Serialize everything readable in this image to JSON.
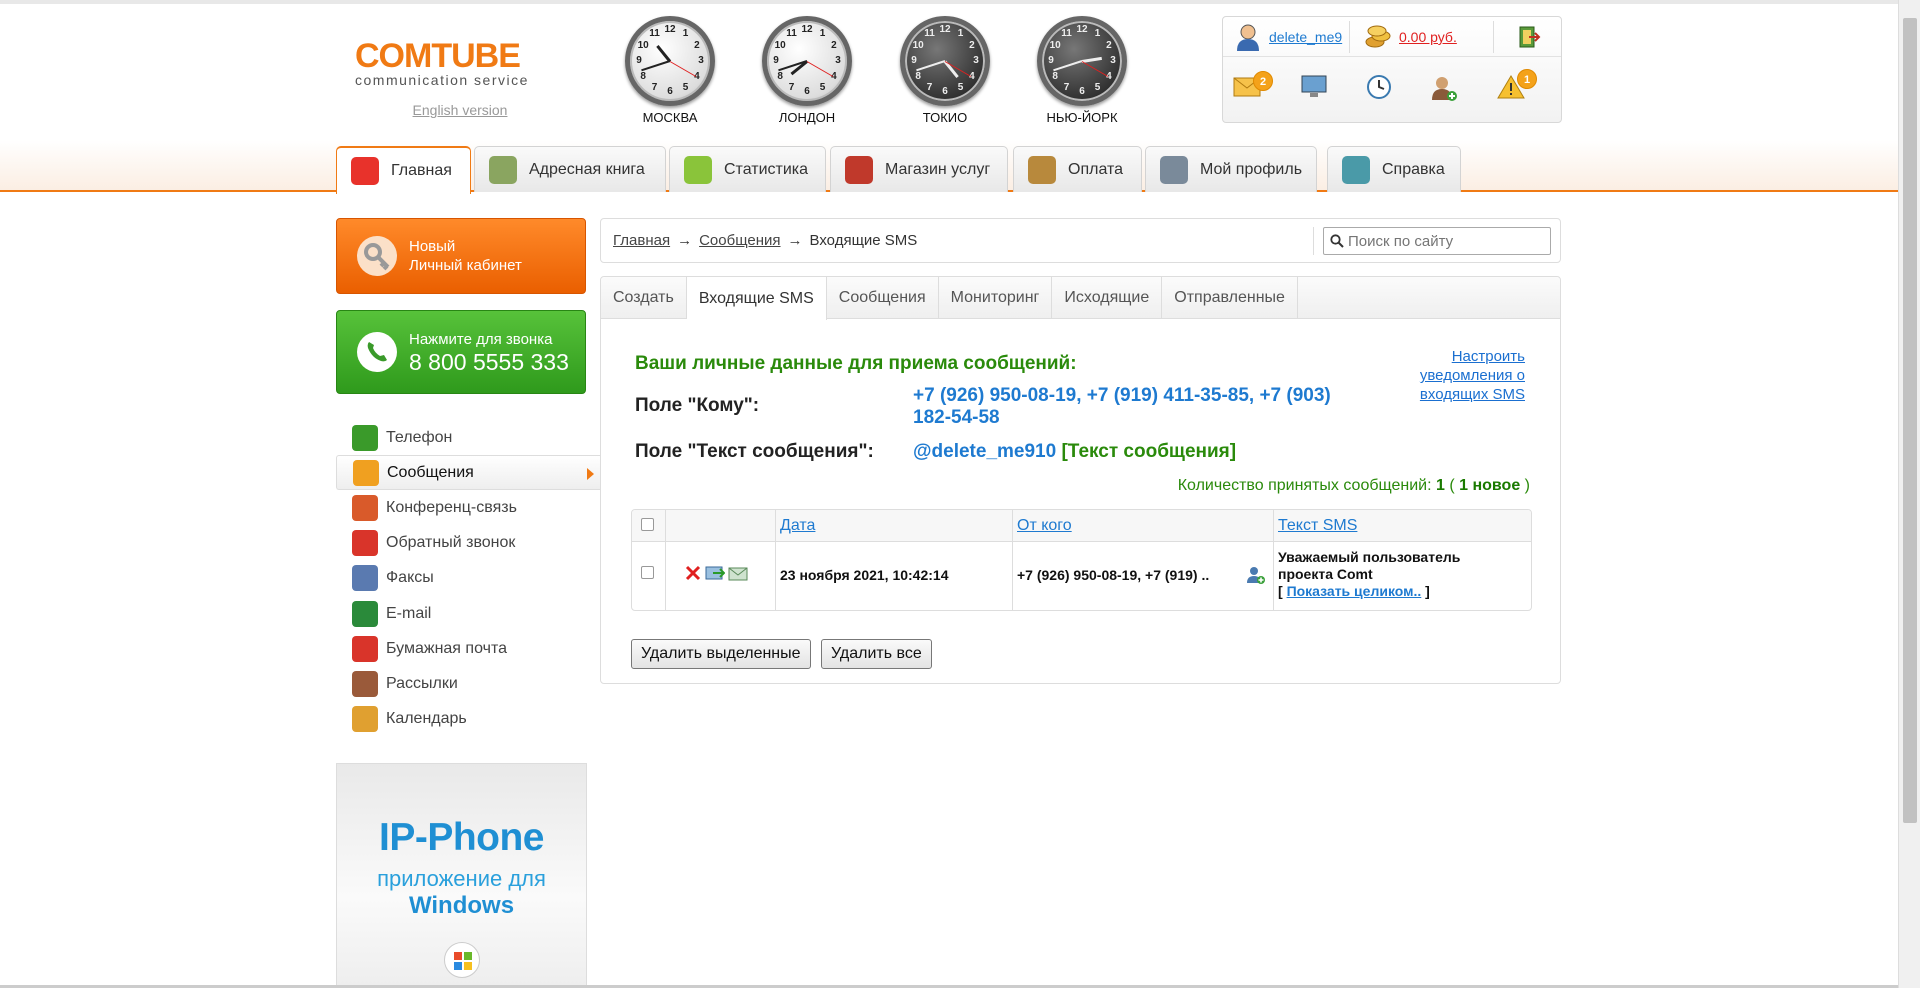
{
  "logo": {
    "brand": "COMTUBE",
    "tagline": "communication service",
    "english_link": "English version"
  },
  "clocks": [
    {
      "city": "МОСКВА",
      "theme": "light",
      "hour": 10,
      "minute": 42
    },
    {
      "city": "ЛОНДОН",
      "theme": "light",
      "hour": 7,
      "minute": 42
    },
    {
      "city": "ТОКИО",
      "theme": "dark",
      "hour": 4,
      "minute": 42
    },
    {
      "city": "НЬЮ-ЙОРК",
      "theme": "dark",
      "hour": 2,
      "minute": 42
    }
  ],
  "userbox": {
    "username": "delete_me9",
    "balance": "0.00 руб.",
    "mail_badge": "2",
    "alert_badge": "1",
    "icons": [
      "user-icon",
      "coins-icon",
      "exit-door-icon",
      "mail-icon",
      "monitor-icon",
      "clock-icon",
      "add-contact-icon",
      "warning-icon"
    ]
  },
  "nav": {
    "tabs": [
      {
        "label": "Главная",
        "color": "#e8322b"
      },
      {
        "label": "Адресная книга",
        "color": "#8aa560"
      },
      {
        "label": "Статистика",
        "color": "#8ac43a"
      },
      {
        "label": "Магазин услуг",
        "color": "#c0392b"
      },
      {
        "label": "Оплата",
        "color": "#b8893c"
      },
      {
        "label": "Мой профиль",
        "color": "#7a8a9a"
      },
      {
        "label": "Справка",
        "color": "#4a9aa8"
      }
    ]
  },
  "promos": {
    "cabinet_line1": "Новый",
    "cabinet_line2": "Личный кабинет",
    "call_line1": "Нажмите для звонка",
    "call_line2": "8 800 5555 333"
  },
  "sidebar": {
    "items": [
      {
        "label": "Телефон",
        "color": "#3a9a2a"
      },
      {
        "label": "Сообщения",
        "color": "#f0a020"
      },
      {
        "label": "Конференц-связь",
        "color": "#d95a2a"
      },
      {
        "label": "Обратный звонок",
        "color": "#d9342a"
      },
      {
        "label": "Факсы",
        "color": "#5a7ab0"
      },
      {
        "label": "E-mail",
        "color": "#2a8a3a"
      },
      {
        "label": "Бумажная почта",
        "color": "#d9342a"
      },
      {
        "label": "Рассылки",
        "color": "#9a5a3a"
      },
      {
        "label": "Календарь",
        "color": "#e0a030"
      }
    ]
  },
  "banner": {
    "title": "IP-Phone",
    "line1": "приложение для",
    "line2": "Windows"
  },
  "breadcrumb": {
    "home": "Главная",
    "arrow": "→",
    "messages": "Сообщения",
    "current": "Входящие SMS"
  },
  "search": {
    "placeholder": "Поиск по сайту"
  },
  "panel_tabs": [
    "Создать",
    "Входящие SMS",
    "Сообщения",
    "Мониторинг",
    "Исходящие",
    "Отправленные"
  ],
  "info": {
    "heading": "Ваши личные данные для приема сообщений:",
    "to_label": "Поле \"Кому\":",
    "to_value": "+7 (926) 950-08-19, +7 (919) 411-35-85, +7 (903) 182-54-58",
    "text_label": "Поле \"Текст сообщения\":",
    "text_value_user": "@delete_me910",
    "text_value_rest": "[Текст сообщения]",
    "configure_link": "Настроить уведомления о входящих SMS",
    "count_prefix": "Количество принятых сообщений:",
    "count_total": "1",
    "count_paren_open": "(",
    "count_new": "1 новое",
    "count_paren_close": ")"
  },
  "table": {
    "headers": {
      "date": "Дата",
      "from": "От кого",
      "text": "Текст SMS"
    },
    "row": {
      "date": "23 ноября 2021, 10:42:14",
      "from": "+7 (926) 950-08-19, +7 (919) ..",
      "text_line1": "Уважаемый пользователь",
      "text_line2": "проекта Comt",
      "show_open": "[",
      "show_link": "Показать целиком..",
      "show_close": "]"
    }
  },
  "buttons": {
    "delete_selected": "Удалить выделенные",
    "delete_all": "Удалить все"
  },
  "colors": {
    "accent": "#f07a14",
    "green_text": "#2a8a0b",
    "link_blue": "#1e7ad0"
  }
}
